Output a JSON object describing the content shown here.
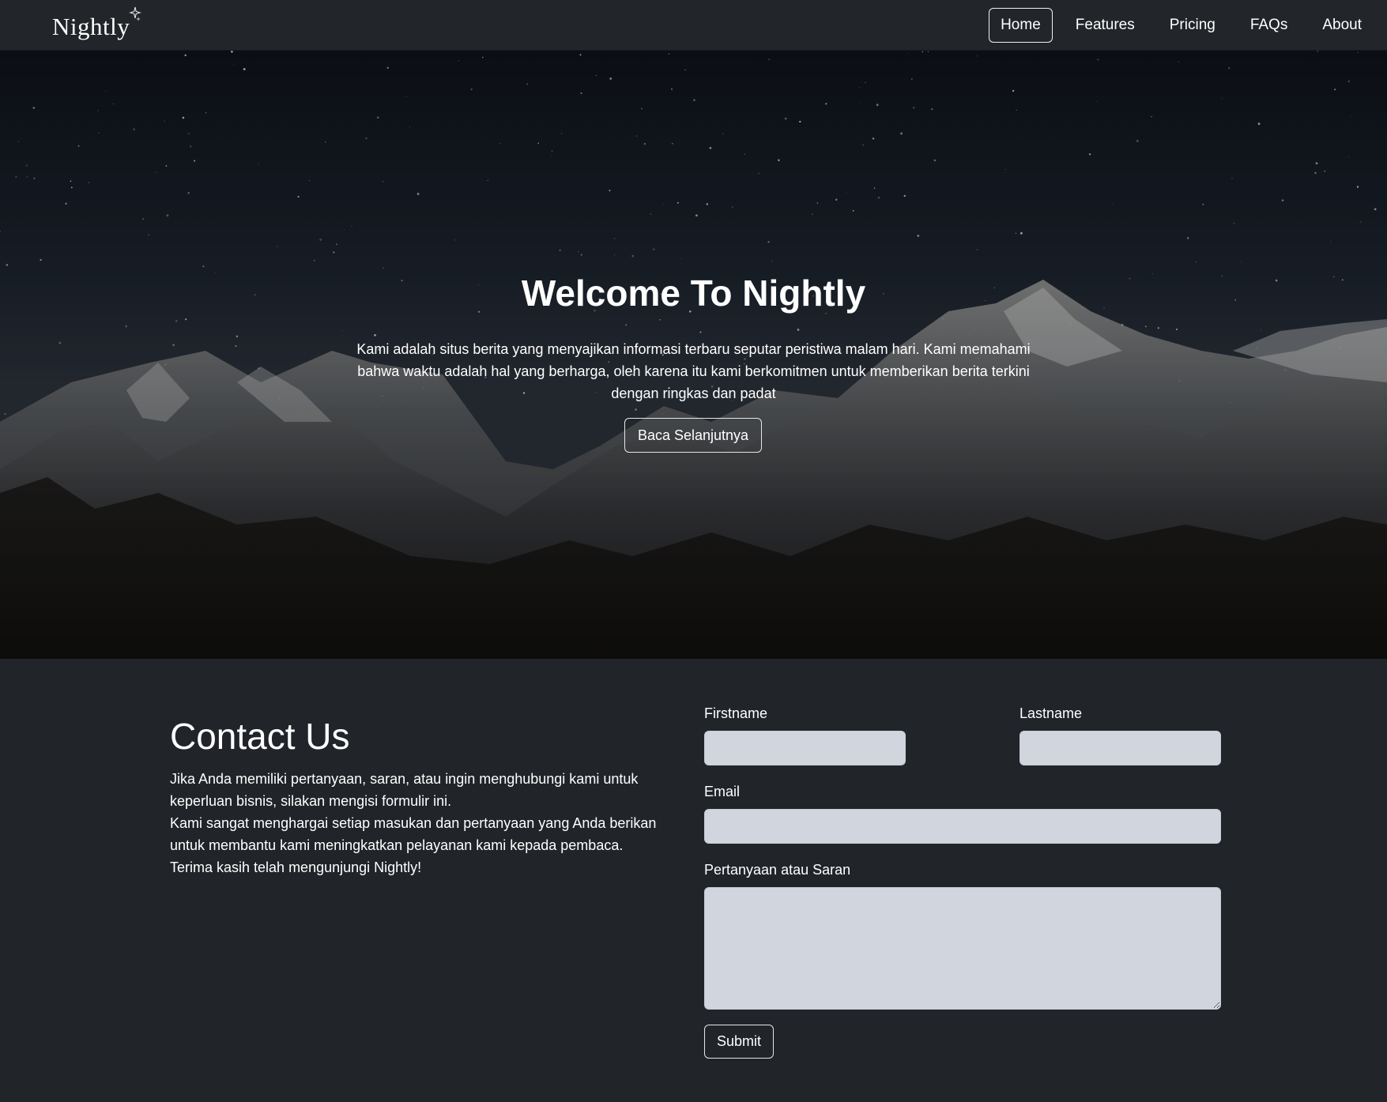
{
  "navbar": {
    "brand": "Nightly",
    "links": [
      {
        "label": "Home",
        "active": true
      },
      {
        "label": "Features",
        "active": false
      },
      {
        "label": "Pricing",
        "active": false
      },
      {
        "label": "FAQs",
        "active": false
      },
      {
        "label": "About",
        "active": false
      }
    ]
  },
  "hero": {
    "title": "Welcome To Nightly",
    "text": "Kami adalah situs berita yang menyajikan informasi terbaru seputar peristiwa malam hari. Kami memahami bahwa waktu adalah hal yang berharga, oleh karena itu kami berkomitmen untuk memberikan berita terkini dengan ringkas dan padat",
    "button_label": "Baca Selanjutnya"
  },
  "contact": {
    "title": "Contact Us",
    "paragraphs": [
      "Jika Anda memiliki pertanyaan, saran, atau ingin menghubungi kami untuk keperluan bisnis, silakan mengisi formulir ini.",
      "Kami sangat menghargai setiap masukan dan pertanyaan yang Anda berikan untuk membantu kami meningkatkan pelayanan kami kepada pembaca.",
      "Terima kasih telah mengunjungi Nightly!"
    ],
    "form": {
      "firstname_label": "Firstname",
      "firstname_value": "",
      "lastname_label": "Lastname",
      "lastname_value": "",
      "email_label": "Email",
      "email_value": "",
      "message_label": "Pertanyaan atau Saran",
      "message_value": "",
      "submit_label": "Submit"
    }
  },
  "colors": {
    "page_bg": "#212429",
    "navbar_bg": "#222529",
    "input_bg": "#d1d5dd",
    "text": "#ffffff"
  }
}
